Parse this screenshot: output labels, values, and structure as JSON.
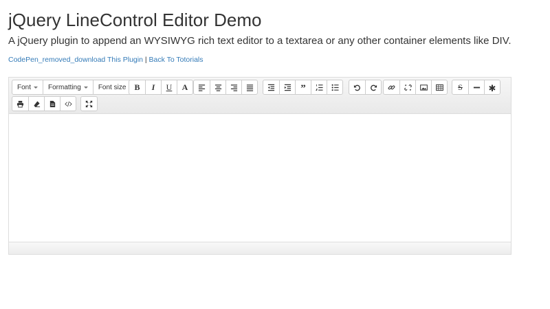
{
  "page": {
    "title": "jQuery LineControl Editor Demo",
    "subtitle": "A jQuery plugin to append an WYSIWYG rich text editor to a textarea or any other container elements like DIV.",
    "links": {
      "download": "CodePen_removed_download This Plugin",
      "separator": "|",
      "tutorials": "Back To Totorials"
    }
  },
  "editor": {
    "dropdowns": {
      "font": "Font",
      "formatting": "Formatting",
      "font_size": "Font size"
    },
    "icons": {
      "bold": "B",
      "italic": "I",
      "underline": "U",
      "font_color": "A"
    },
    "toolbar_buttons": [
      "bold",
      "italic",
      "underline",
      "font-color",
      "align-left",
      "align-center",
      "align-right",
      "justify",
      "outdent",
      "indent",
      "blockquote",
      "ordered-list",
      "unordered-list",
      "undo",
      "redo",
      "insert-link",
      "unlink",
      "insert-image",
      "insert-table",
      "strikethrough",
      "horizontal-rule",
      "special-characters",
      "print",
      "remove-formatting",
      "select-all",
      "source-code",
      "fullscreen"
    ],
    "content": ""
  },
  "colors": {
    "link": "#337ab7",
    "toolbar_bg": "#efefef",
    "border": "#cccccc"
  }
}
